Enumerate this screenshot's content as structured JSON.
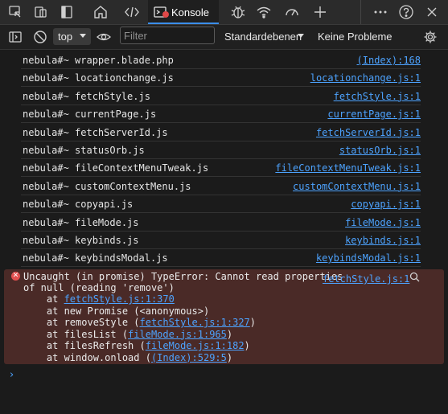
{
  "toolbar": {
    "active_tab_label": "Konsole",
    "icons": [
      "inspect-icon",
      "device-emulation-icon",
      "sidebar-icon",
      "welcome-icon",
      "elements-icon",
      "console-icon",
      "debug-icon",
      "network-icon",
      "performance-icon",
      "add-tool-icon",
      "more-icon",
      "help-icon",
      "close-icon"
    ]
  },
  "filterbar": {
    "context": "top",
    "filter_placeholder": "Filter",
    "levels": "Standardebenen",
    "problems": "Keine Probleme"
  },
  "rows": [
    {
      "msg": "nebula#~ wrapper.blade.php",
      "src": "(Index):168"
    },
    {
      "msg": "nebula#~ locationchange.js",
      "src": "locationchange.js:1"
    },
    {
      "msg": "nebula#~ fetchStyle.js",
      "src": "fetchStyle.js:1"
    },
    {
      "msg": "nebula#~ currentPage.js",
      "src": "currentPage.js:1"
    },
    {
      "msg": "nebula#~ fetchServerId.js",
      "src": "fetchServerId.js:1"
    },
    {
      "msg": "nebula#~ statusOrb.js",
      "src": "statusOrb.js:1"
    },
    {
      "msg": "nebula#~ fileContextMenuTweak.js",
      "src": "fileContextMenuTweak.js:1"
    },
    {
      "msg": "nebula#~ customContextMenu.js",
      "src": "customContextMenu.js:1"
    },
    {
      "msg": "nebula#~ copyapi.js",
      "src": "copyapi.js:1"
    },
    {
      "msg": "nebula#~ fileMode.js",
      "src": "fileMode.js:1"
    },
    {
      "msg": "nebula#~ keybinds.js",
      "src": "keybinds.js:1"
    },
    {
      "msg": "nebula#~ keybindsModal.js",
      "src": "keybindsModal.js:1"
    }
  ],
  "error": {
    "line1": "Uncaught (in promise) TypeError: Cannot read properties",
    "line2": "of null (reading 'remove')",
    "src": "fetchStyle.js:1",
    "stack": [
      {
        "pre": "    at ",
        "link": "fetchStyle.js:1:370",
        "post": ""
      },
      {
        "pre": "    at new Promise (<anonymous>)",
        "link": "",
        "post": ""
      },
      {
        "pre": "    at removeStyle (",
        "link": "fetchStyle.js:1:327",
        "post": ")"
      },
      {
        "pre": "    at filesList (",
        "link": "fileMode.js:1:965",
        "post": ")"
      },
      {
        "pre": "    at filesRefresh (",
        "link": "fileMode.js:1:182",
        "post": ")"
      },
      {
        "pre": "    at window.onload (",
        "link": "(Index):529:5",
        "post": ")"
      }
    ]
  },
  "prompt": "›"
}
